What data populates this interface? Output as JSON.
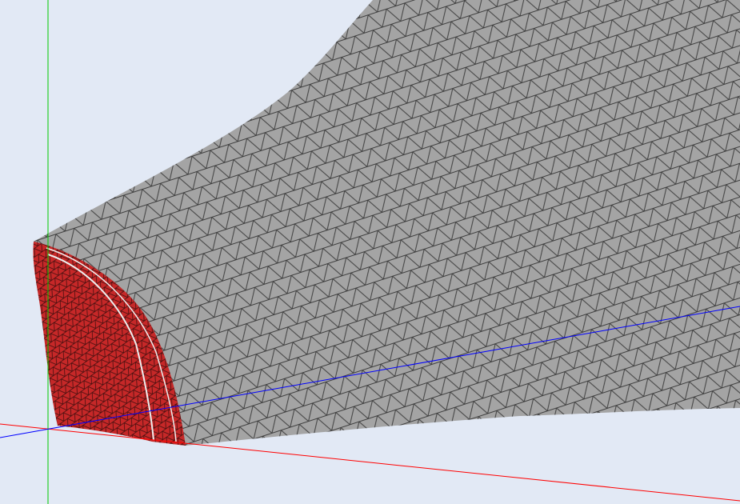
{
  "viewport": {
    "background_color": "#e2e9f5",
    "body_color": "#a4a4a4",
    "section_color": "#c62828",
    "mesh_line_color": "#333333",
    "mesh_element_type": "triangle"
  },
  "axes": {
    "x_color": "#ff0000",
    "y_color": "#00cc00",
    "z_color": "#0000ff"
  }
}
